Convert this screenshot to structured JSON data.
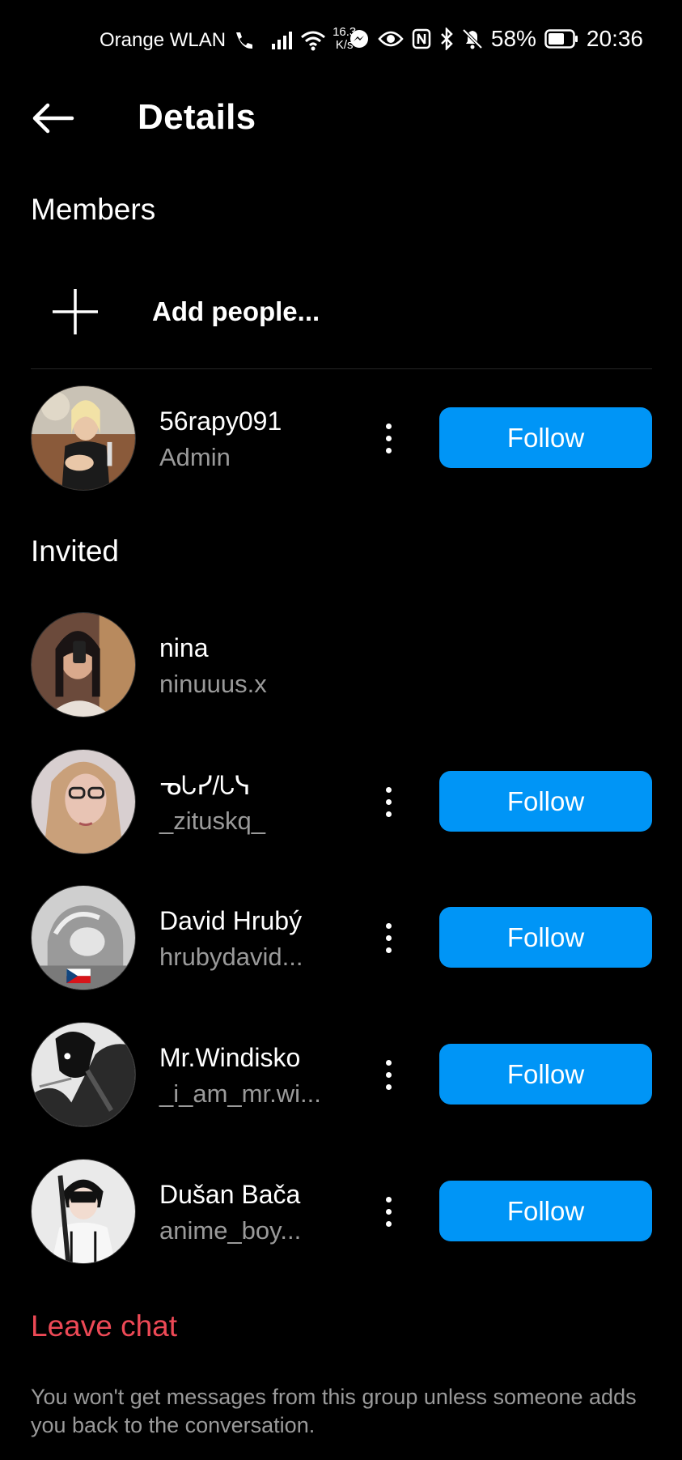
{
  "status_bar": {
    "carrier": "Orange WLAN",
    "speed_value": "16.3",
    "speed_unit": "K/s",
    "battery": "58%",
    "time": "20:36",
    "icons": [
      "wifi-call-icon",
      "signal-icon",
      "wifi-icon",
      "messenger-icon",
      "eye-icon",
      "nfc-icon",
      "bluetooth-icon",
      "bell-off-icon",
      "battery-icon"
    ]
  },
  "header": {
    "title": "Details",
    "back_icon": "arrow-left-icon"
  },
  "members_section": {
    "title": "Members",
    "add_label": "Add people...",
    "members": [
      {
        "name": "56rapy091",
        "sub": "Admin",
        "follow": "Follow"
      }
    ]
  },
  "invited_section": {
    "title": "Invited",
    "users": [
      {
        "name": "nina",
        "sub": "ninuuus.x"
      },
      {
        "name": "ᓀᘂᓯ/ᘂᓭ",
        "sub": "_zituskq_",
        "follow": "Follow"
      },
      {
        "name": "David Hrubý",
        "sub": "hrubydavid...",
        "follow": "Follow"
      },
      {
        "name": "Mr.Windisko",
        "sub": "_i_am_mr.wi...",
        "follow": "Follow"
      },
      {
        "name": "Dušan Bača",
        "sub": "anime_boy...",
        "follow": "Follow"
      }
    ]
  },
  "footer": {
    "leave_label": "Leave chat",
    "note": "You won't get messages from this group unless someone adds you back to the conversation."
  },
  "colors": {
    "background": "#000000",
    "follow_blue": "#0095f6",
    "leave_red": "#ed4956",
    "secondary_text": "#9a9a9a"
  }
}
